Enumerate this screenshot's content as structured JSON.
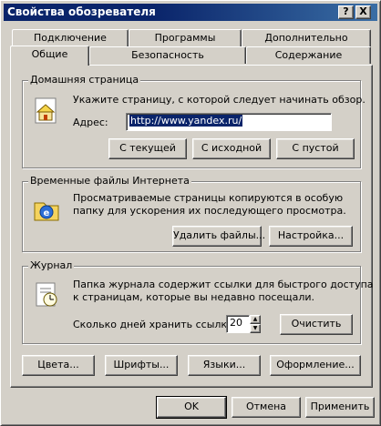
{
  "window": {
    "title": "Свойства обозревателя",
    "help_button": "?",
    "close_button": "X"
  },
  "tabs": {
    "row_back": [
      "Подключение",
      "Программы",
      "Дополнительно"
    ],
    "row_front": [
      "Общие",
      "Безопасность",
      "Содержание"
    ],
    "active": "Общие"
  },
  "home_page": {
    "group_title": "Домашняя страница",
    "description": "Укажите страницу, с которой следует начинать обзор.",
    "address_label": "Адрес:",
    "address_value": "http://www.yandex.ru/",
    "btn_current": "С текущей",
    "btn_default": "С исходной",
    "btn_blank": "С пустой",
    "icon": "home-page-icon"
  },
  "temp_files": {
    "group_title": "Временные файлы Интернета",
    "description_line1": "Просматриваемые страницы копируются в особую",
    "description_line2": "папку для ускорения их последующего просмотра.",
    "btn_delete": "Удалить файлы...",
    "btn_settings": "Настройка...",
    "icon": "ie-temp-files-icon"
  },
  "history": {
    "group_title": "Журнал",
    "description_line1": "Папка журнала содержит ссылки для быстрого доступа",
    "description_line2": "к страницам, которые вы недавно посещали.",
    "days_label": "Сколько дней хранить ссылки:",
    "days_value": "20",
    "btn_clear": "Очистить",
    "icon": "history-icon"
  },
  "bottom_row": {
    "colors": "Цвета...",
    "fonts": "Шрифты...",
    "languages": "Языки...",
    "appearance": "Оформление..."
  },
  "dialog_buttons": {
    "ok": "OK",
    "cancel": "Отмена",
    "apply": "Применить"
  },
  "colors": {
    "titlebar": "#0a246a",
    "face": "#d4d0c8",
    "selection": "#0a246a"
  }
}
